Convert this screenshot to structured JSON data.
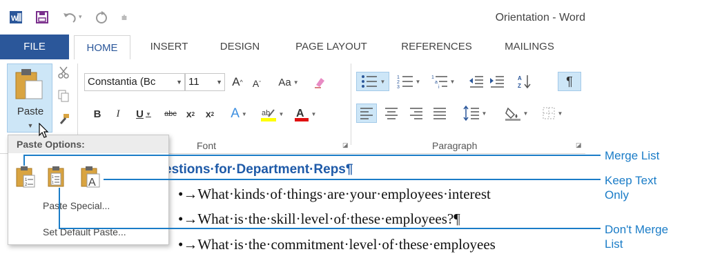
{
  "window": {
    "title": "Orientation - Word"
  },
  "tabs": [
    {
      "label": "FILE"
    },
    {
      "label": "HOME"
    },
    {
      "label": "INSERT"
    },
    {
      "label": "DESIGN"
    },
    {
      "label": "PAGE LAYOUT"
    },
    {
      "label": "REFERENCES"
    },
    {
      "label": "MAILINGS"
    }
  ],
  "clipboard": {
    "paste_label": "Paste"
  },
  "font": {
    "name": "Constantia (Bc",
    "size": "11",
    "case_label": "Aa",
    "group_label": "Font"
  },
  "paragraph": {
    "group_label": "Paragraph"
  },
  "paste_options": {
    "header": "Paste Options:",
    "special": "Paste Special...",
    "set_default": "Set Default Paste..."
  },
  "document": {
    "heading": "estions·for·Department·Reps¶",
    "bullets": [
      "•→What·kinds·of·things·are·your·employees·interest",
      "•→What·is·the·skill·level·of·these·employees?¶",
      "•→What·is·the·commitment·level·of·these·employees"
    ]
  },
  "callouts": {
    "merge_list": "Merge List",
    "keep_text_only_1": "Keep Text",
    "keep_text_only_2": "Only",
    "dont_merge_1": "Don't Merge",
    "dont_merge_2": "List"
  },
  "colors": {
    "accent": "#2b579a",
    "callout": "#1a7cc7",
    "heading": "#1e5aa8"
  }
}
